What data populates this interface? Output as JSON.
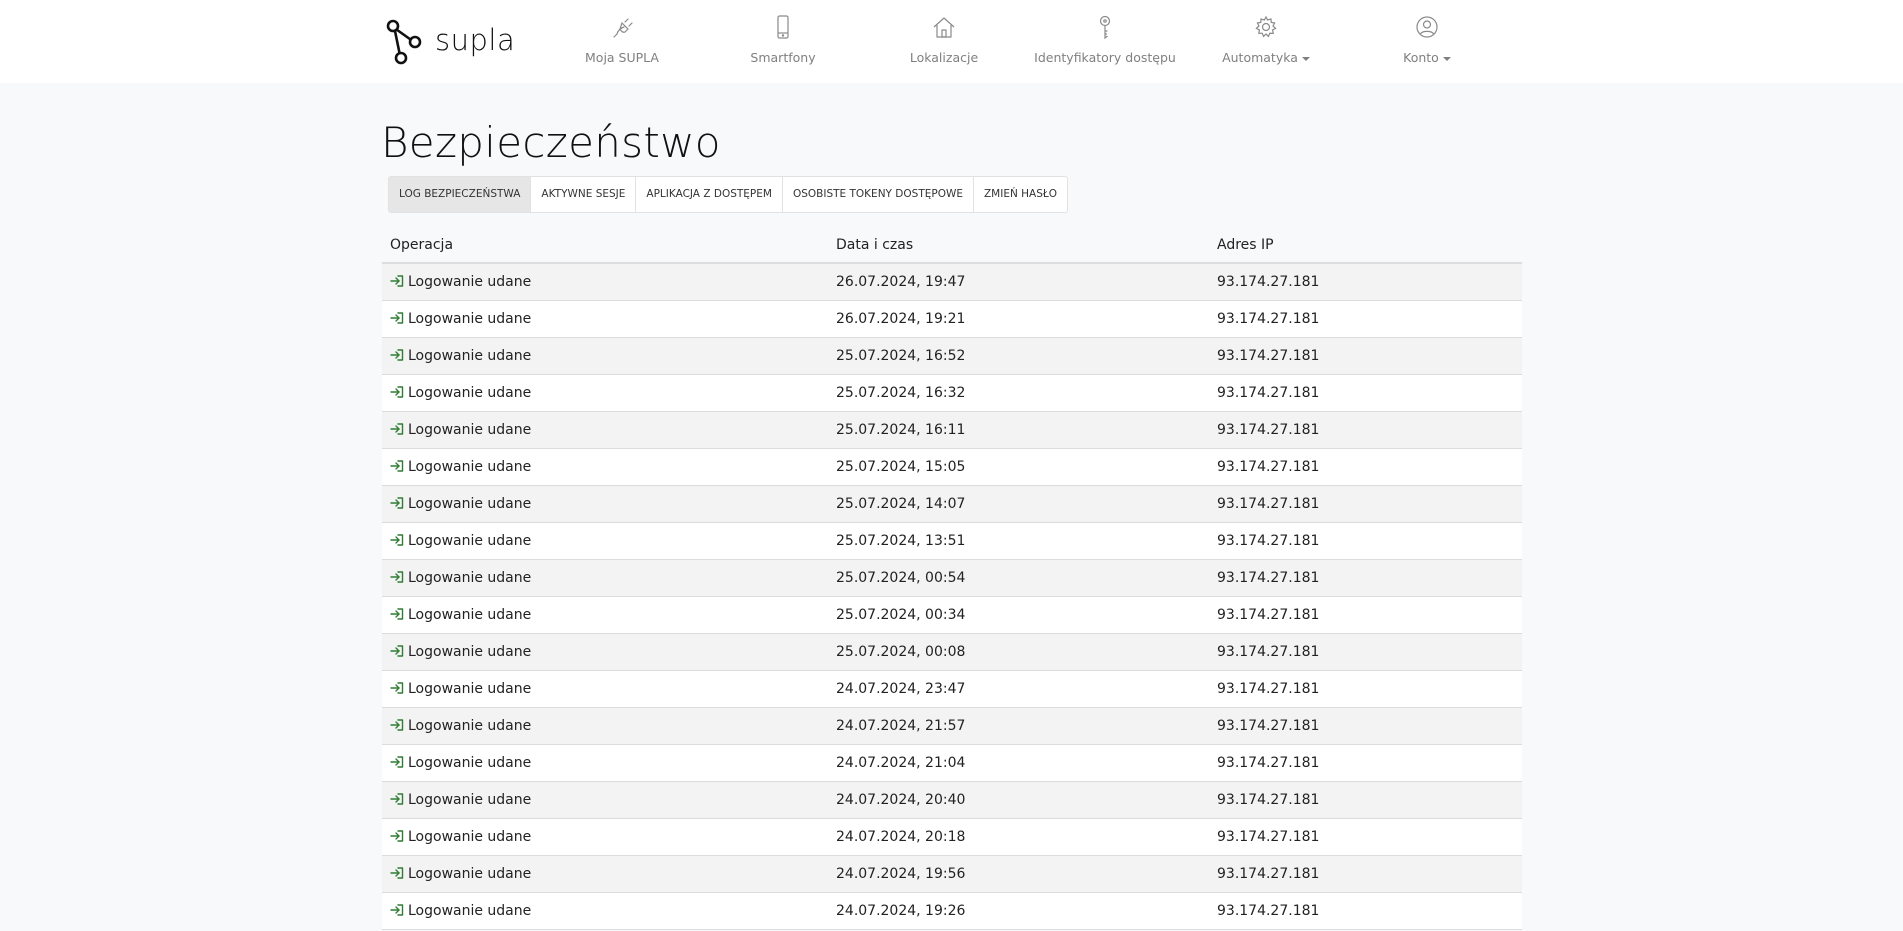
{
  "brand": {
    "name": "supla"
  },
  "nav": [
    {
      "id": "moja-supla",
      "label": "Moja SUPLA",
      "icon": "plug-icon",
      "caret": false
    },
    {
      "id": "smartfony",
      "label": "Smartfony",
      "icon": "smartphone-icon",
      "caret": false
    },
    {
      "id": "lokalizacje",
      "label": "Lokalizacje",
      "icon": "home-icon",
      "caret": false
    },
    {
      "id": "identyfikatory",
      "label": "Identyfikatory dostępu",
      "icon": "key-icon",
      "caret": false
    },
    {
      "id": "automatyka",
      "label": "Automatyka",
      "icon": "gear-icon",
      "caret": true
    },
    {
      "id": "konto",
      "label": "Konto",
      "icon": "user-icon",
      "caret": true
    }
  ],
  "page": {
    "title": "Bezpieczeństwo"
  },
  "tabs": [
    {
      "label": "Log bezpieczeństwa",
      "active": true
    },
    {
      "label": "Aktywne sesje",
      "active": false
    },
    {
      "label": "Aplikacja z dostępem",
      "active": false
    },
    {
      "label": "Osobiste tokeny dostępowe",
      "active": false
    },
    {
      "label": "Zmień hasło",
      "active": false
    }
  ],
  "table": {
    "columns": [
      "Operacja",
      "Data i czas",
      "Adres IP"
    ],
    "success_color": "#2e7d32",
    "rows": [
      {
        "operation": "Logowanie udane",
        "datetime": "26.07.2024, 19:47",
        "ip": "93.174.27.181"
      },
      {
        "operation": "Logowanie udane",
        "datetime": "26.07.2024, 19:21",
        "ip": "93.174.27.181"
      },
      {
        "operation": "Logowanie udane",
        "datetime": "25.07.2024, 16:52",
        "ip": "93.174.27.181"
      },
      {
        "operation": "Logowanie udane",
        "datetime": "25.07.2024, 16:32",
        "ip": "93.174.27.181"
      },
      {
        "operation": "Logowanie udane",
        "datetime": "25.07.2024, 16:11",
        "ip": "93.174.27.181"
      },
      {
        "operation": "Logowanie udane",
        "datetime": "25.07.2024, 15:05",
        "ip": "93.174.27.181"
      },
      {
        "operation": "Logowanie udane",
        "datetime": "25.07.2024, 14:07",
        "ip": "93.174.27.181"
      },
      {
        "operation": "Logowanie udane",
        "datetime": "25.07.2024, 13:51",
        "ip": "93.174.27.181"
      },
      {
        "operation": "Logowanie udane",
        "datetime": "25.07.2024, 00:54",
        "ip": "93.174.27.181"
      },
      {
        "operation": "Logowanie udane",
        "datetime": "25.07.2024, 00:34",
        "ip": "93.174.27.181"
      },
      {
        "operation": "Logowanie udane",
        "datetime": "25.07.2024, 00:08",
        "ip": "93.174.27.181"
      },
      {
        "operation": "Logowanie udane",
        "datetime": "24.07.2024, 23:47",
        "ip": "93.174.27.181"
      },
      {
        "operation": "Logowanie udane",
        "datetime": "24.07.2024, 21:57",
        "ip": "93.174.27.181"
      },
      {
        "operation": "Logowanie udane",
        "datetime": "24.07.2024, 21:04",
        "ip": "93.174.27.181"
      },
      {
        "operation": "Logowanie udane",
        "datetime": "24.07.2024, 20:40",
        "ip": "93.174.27.181"
      },
      {
        "operation": "Logowanie udane",
        "datetime": "24.07.2024, 20:18",
        "ip": "93.174.27.181"
      },
      {
        "operation": "Logowanie udane",
        "datetime": "24.07.2024, 19:56",
        "ip": "93.174.27.181"
      },
      {
        "operation": "Logowanie udane",
        "datetime": "24.07.2024, 19:26",
        "ip": "93.174.27.181"
      }
    ]
  }
}
